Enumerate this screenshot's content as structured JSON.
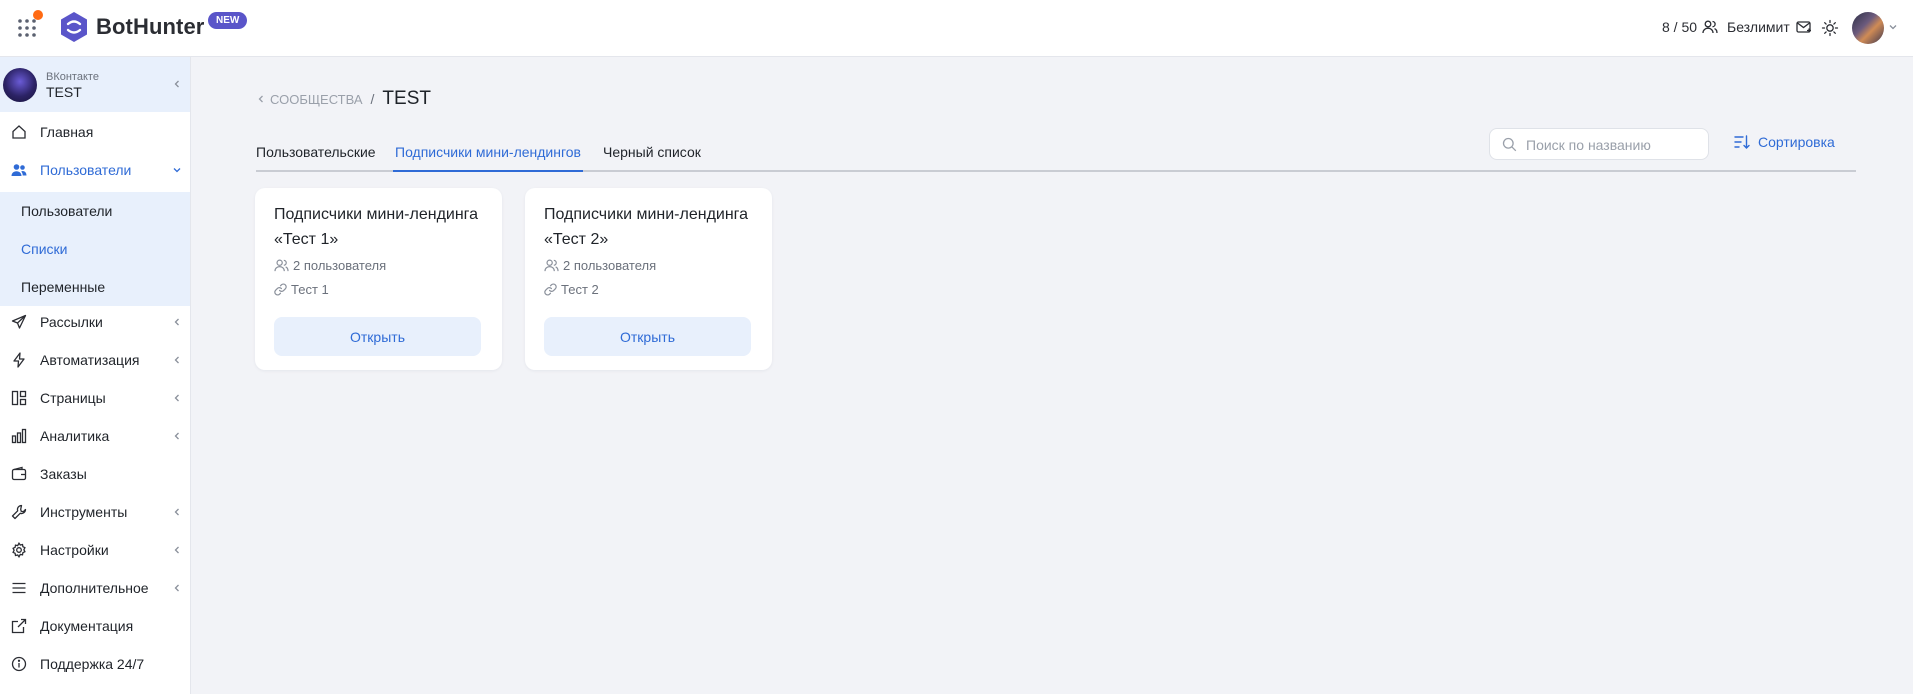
{
  "header": {
    "brand": "BotHunter",
    "badge": "NEW",
    "quota": "8 / 50",
    "plan": "Безлимит",
    "icons": {
      "apps": "apps-grid-icon",
      "users": "users-icon",
      "plan": "mail-icon",
      "theme": "sun-icon"
    },
    "colors": {
      "accent": "#2f6bd6",
      "notification": "#ff6a13",
      "logo": "#5a55c9"
    }
  },
  "account": {
    "network": "ВКонтакте",
    "name": "TEST"
  },
  "sidebar": {
    "items": [
      {
        "label": "Главная",
        "icon": "home-icon"
      },
      {
        "label": "Пользователи",
        "icon": "users-icon",
        "expanded": true,
        "active": true
      },
      {
        "label": "Рассылки",
        "icon": "send-icon"
      },
      {
        "label": "Автоматизация",
        "icon": "bolt-icon"
      },
      {
        "label": "Страницы",
        "icon": "layout-icon"
      },
      {
        "label": "Аналитика",
        "icon": "bar-chart-icon"
      },
      {
        "label": "Заказы",
        "icon": "wallet-icon"
      },
      {
        "label": "Инструменты",
        "icon": "wrench-icon"
      },
      {
        "label": "Настройки",
        "icon": "gear-icon"
      },
      {
        "label": "Дополнительное",
        "icon": "menu-icon"
      },
      {
        "label": "Документация",
        "icon": "external-link-icon"
      },
      {
        "label": "Поддержка 24/7",
        "icon": "info-icon"
      }
    ],
    "subitems": [
      {
        "label": "Пользователи"
      },
      {
        "label": "Списки",
        "active": true
      },
      {
        "label": "Переменные"
      }
    ]
  },
  "breadcrumb": {
    "back": "СООБЩЕСТВА",
    "separator": "/",
    "title": "TEST"
  },
  "tabs": [
    {
      "label": "Пользовательские"
    },
    {
      "label": "Подписчики мини-лендингов",
      "active": true
    },
    {
      "label": "Черный список"
    }
  ],
  "search": {
    "placeholder": "Поиск по названию",
    "value": ""
  },
  "sort": {
    "label": "Сортировка"
  },
  "cards": [
    {
      "title": "Подписчики мини-лендинга «Тест 1»",
      "users": "2 пользователя",
      "link": "Тест 1",
      "button": "Открыть"
    },
    {
      "title": "Подписчики мини-лендинга «Тест 2»",
      "users": "2 пользователя",
      "link": "Тест 2",
      "button": "Открыть"
    }
  ]
}
